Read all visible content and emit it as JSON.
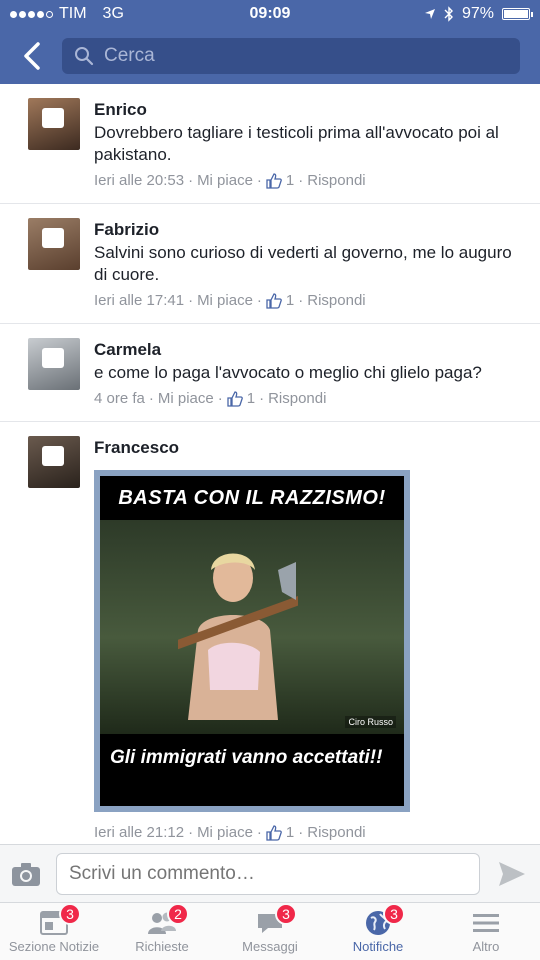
{
  "status": {
    "carrier": "TIM",
    "network": "3G",
    "time": "09:09",
    "battery": "97%"
  },
  "header": {
    "search_placeholder": "Cerca"
  },
  "comments": [
    {
      "name": "Enrico",
      "text": "Dovrebbero tagliare i testicoli prima all'avvocato poi al pakistano.",
      "time": "Ieri alle 20:53",
      "like_label": "Mi piace",
      "like_count": "1",
      "reply_label": "Rispondi",
      "avatar_color": "#6b4e3a"
    },
    {
      "name": "Fabrizio",
      "text": "Salvini sono curioso di vederti al governo, me lo auguro di cuore.",
      "time": "Ieri alle 17:41",
      "like_label": "Mi piace",
      "like_count": "1",
      "reply_label": "Rispondi",
      "avatar_color": "#7a5b46"
    },
    {
      "name": "Carmela",
      "text": "e come lo paga l'avvocato o meglio chi glielo paga?",
      "time": "4 ore fa",
      "like_label": "Mi piace",
      "like_count": "1",
      "reply_label": "Rispondi",
      "avatar_color": "#8c9298"
    },
    {
      "name": "Francesco",
      "text": "",
      "time": "Ieri alle 21:12",
      "like_label": "Mi piace",
      "like_count": "1",
      "reply_label": "Rispondi",
      "avatar_color": "#4a3f38",
      "image": {
        "top_text": "BASTA CON IL RAZZISMO!",
        "bottom_text": "Gli immigrati vanno accettati!!",
        "credit": "Ciro Russo"
      }
    }
  ],
  "compose": {
    "placeholder": "Scrivi un commento…"
  },
  "tabs": [
    {
      "label": "Sezione Notizie",
      "badge": "3",
      "icon": "news-feed-icon"
    },
    {
      "label": "Richieste",
      "badge": "2",
      "icon": "friend-requests-icon"
    },
    {
      "label": "Messaggi",
      "badge": "3",
      "icon": "messages-icon"
    },
    {
      "label": "Notifiche",
      "badge": "3",
      "icon": "notifications-globe-icon",
      "active": true
    },
    {
      "label": "Altro",
      "badge": "",
      "icon": "menu-icon"
    }
  ],
  "colors": {
    "brand": "#4a67a8",
    "badge": "#f02849"
  }
}
